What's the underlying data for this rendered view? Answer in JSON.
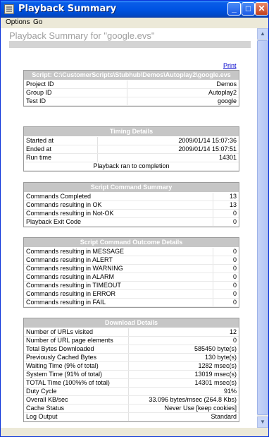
{
  "window": {
    "title": "Playback Summary"
  },
  "menu": {
    "options": "Options",
    "go": "Go"
  },
  "page": {
    "heading": "Playback Summary for \"google.evs\"",
    "print": "Print"
  },
  "script": {
    "header": "Script: C:\\CustomerScripts\\Stubhub\\Demos\\Autoplay2\\google.evs",
    "rows": [
      {
        "label": "Project ID",
        "value": "Demos"
      },
      {
        "label": "Group ID",
        "value": "Autoplay2"
      },
      {
        "label": "Test ID",
        "value": "google"
      }
    ]
  },
  "timing": {
    "header": "Timing Details",
    "rows": [
      {
        "label": "Started at",
        "value": "2009/01/14 15:07:36"
      },
      {
        "label": "Ended at",
        "value": "2009/01/14 15:07:51"
      },
      {
        "label": "Run time",
        "value": "14301"
      }
    ],
    "note": "Playback ran to completion"
  },
  "summary": {
    "header": "Script Command Summary",
    "rows": [
      {
        "label": "Commands Completed",
        "value": "13"
      },
      {
        "label": "Commands resulting in OK",
        "value": "13"
      },
      {
        "label": "Commands resulting in Not-OK",
        "value": "0"
      },
      {
        "label": "Playback Exit Code",
        "value": "0"
      }
    ]
  },
  "outcome": {
    "header": "Script Command Outcome Details",
    "rows": [
      {
        "label": "Commands resulting in MESSAGE",
        "value": "0"
      },
      {
        "label": "Commands resulting in ALERT",
        "value": "0"
      },
      {
        "label": "Commands resulting in WARNING",
        "value": "0"
      },
      {
        "label": "Commands resulting in ALARM",
        "value": "0"
      },
      {
        "label": "Commands resulting in TIMEOUT",
        "value": "0"
      },
      {
        "label": "Commands resulting in ERROR",
        "value": "0"
      },
      {
        "label": "Commands resulting in FAIL",
        "value": "0"
      }
    ]
  },
  "download": {
    "header": "Download Details",
    "rows": [
      {
        "label": "Number of URLs visited",
        "value": "12"
      },
      {
        "label": "Number of URL page elements",
        "value": "0"
      },
      {
        "label": "Total Bytes Downloaded",
        "value": "585450 byte(s)"
      },
      {
        "label": "Previously Cached Bytes",
        "value": "130 byte(s)"
      },
      {
        "label": "Waiting Time (9% of total)",
        "value": "1282 msec(s)"
      },
      {
        "label": "System Time (91% of total)",
        "value": "13019 msec(s)"
      },
      {
        "label": "TOTAL Time (100%% of total)",
        "value": "14301 msec(s)"
      },
      {
        "label": "Duty Cycle",
        "value": "91%"
      },
      {
        "label": "Overall KB/sec",
        "value": "33.096 bytes/msec (264.8 Kbs)"
      },
      {
        "label": "Cache Status",
        "value": "Never Use [keep cookies]"
      },
      {
        "label": "Log Output",
        "value": "Standard"
      }
    ]
  }
}
